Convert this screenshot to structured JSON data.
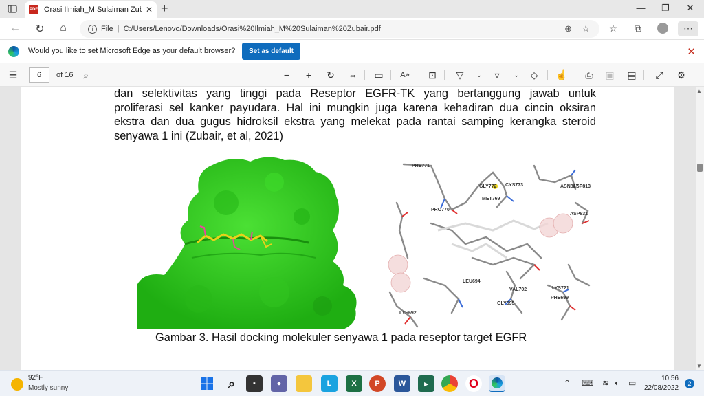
{
  "tab": {
    "title": "Orasi Ilmiah_M Sulaiman Zubair.p",
    "pdf_badge": "PDF",
    "close": "✕"
  },
  "window": {
    "minimize": "—",
    "maximize": "❐",
    "close": "✕"
  },
  "address": {
    "file_label": "File",
    "separator": "|",
    "url": "C:/Users/Lenovo/Downloads/Orasi%20Ilmiah_M%20Sulaiman%20Zubair.pdf"
  },
  "infobar": {
    "message": "Would you like to set Microsoft Edge as your default browser?",
    "button": "Set as default"
  },
  "pdf_toolbar": {
    "page": "6",
    "page_count": "of 16"
  },
  "document": {
    "lines": [
      "dan selektivitas yang tinggi pada Reseptor EGFR-TK yang bertanggung jawab untuk",
      "proliferasi sel kanker payudara. Hal ini mungkin juga karena kehadiran dua cincin oksiran",
      "ekstra dan dua gugus hidroksil ekstra yang melekat pada rantai samping kerangka steroid",
      "senyawa 1 ini (Zubair, et al, 2021)"
    ],
    "caption": "Gambar 3. Hasil docking molekuler senyawa 1 pada reseptor target EGFR",
    "residues": [
      {
        "label": "PHE771"
      },
      {
        "label": "GLY772"
      },
      {
        "label": "CYS773"
      },
      {
        "label": "MET769"
      },
      {
        "label": "PRO770"
      },
      {
        "label": "ASP813"
      },
      {
        "label": "ASN817"
      },
      {
        "label": "ASP831"
      },
      {
        "label": "LEU694"
      },
      {
        "label": "VAL702"
      },
      {
        "label": "GLY695"
      },
      {
        "label": "LYS721"
      },
      {
        "label": "PHE699"
      },
      {
        "label": "LYS692"
      }
    ]
  },
  "taskbar": {
    "temperature": "92°F",
    "condition": "Mostly sunny",
    "time": "10:56",
    "date": "22/08/2022",
    "notifications": "2"
  },
  "colors": {
    "protein": "#2fcc1c",
    "accent": "#0f6cbd",
    "ligand": "#e8d21a"
  }
}
